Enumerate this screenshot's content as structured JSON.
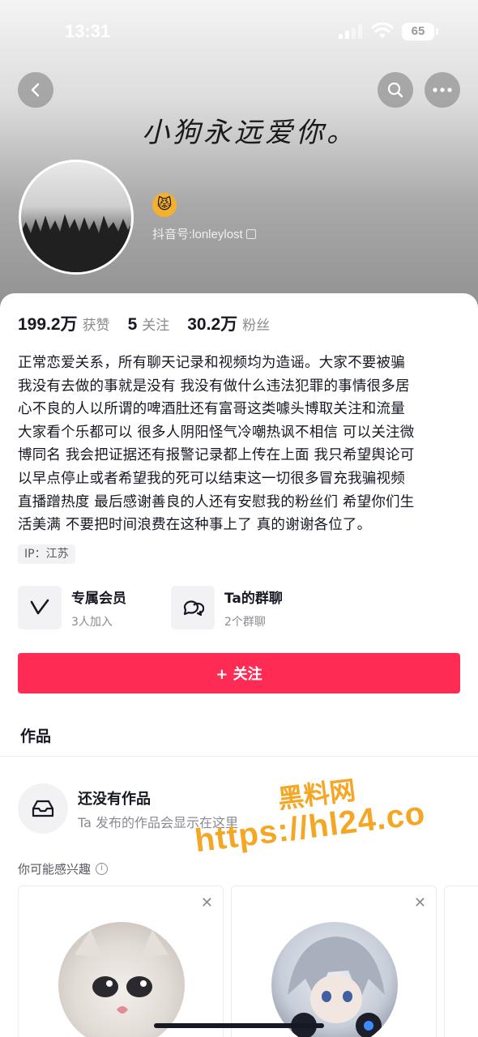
{
  "status_bar": {
    "time": "13:31",
    "battery": "65"
  },
  "header": {
    "banner_text": "小狗永远爱你。",
    "name_emoji": "😾",
    "douyin_id": "抖音号:lonleylost"
  },
  "stats": [
    {
      "value": "199.2万",
      "label": "获赞"
    },
    {
      "value": "5",
      "label": "关注"
    },
    {
      "value": "30.2万",
      "label": "粉丝"
    }
  ],
  "bio": [
    "正常恋爱关系，所有聊天记录和视频均为造谣。大家不要被骗",
    "我没有去做的事就是没有 我没有做什么违法犯罪的事情很多居",
    "心不良的人以所谓的啤酒肚还有富哥这类噱头博取关注和流量",
    "大家看个乐都可以 很多人阴阳怪气冷嘲热讽不相信 可以关注微",
    "博同名 我会把证据还有报警记录都上传在上面 我只希望舆论可",
    "以早点停止或者希望我的死可以结束这一切很多冒充我骗视频",
    "直播蹭热度 最后感谢善良的人还有安慰我的粉丝们 希望你们生",
    "活美满 不要把时间浪费在这种事上了 真的谢谢各位了。"
  ],
  "ip": "IP：江苏",
  "features": {
    "vip": {
      "title": "专属会员",
      "sub": "3人加入"
    },
    "group": {
      "title": "Ta的群聊",
      "sub": "2个群聊"
    }
  },
  "follow_button": "+ 关注",
  "tabs": {
    "works": "作品"
  },
  "empty_state": {
    "title": "还没有作品",
    "sub": "Ta 发布的作品会显示在这里"
  },
  "recommend": {
    "label": "你可能感兴趣"
  },
  "watermark": {
    "line1": "黑料网",
    "line2": "https://hl24.co"
  },
  "colors": {
    "accent": "#fe2c55",
    "text": "#161823",
    "muted": "#8a8b91"
  },
  "icons": [
    "back-icon",
    "search-icon",
    "more-icon",
    "copy-icon",
    "vip-icon",
    "group-chat-icon",
    "inbox-icon",
    "info-icon",
    "close-icon"
  ]
}
